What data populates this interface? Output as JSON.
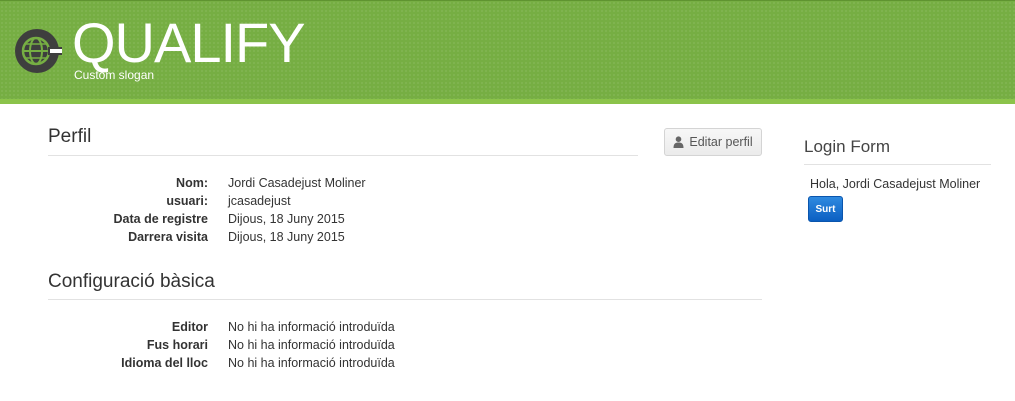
{
  "header": {
    "logo_icon": "globe-logo-icon",
    "site_title": "QUALIFY",
    "slogan": "Custom slogan",
    "colors": {
      "header_bg": "#76ae43",
      "header_stripe": "#8bc34a"
    }
  },
  "profile": {
    "title": "Perfil",
    "edit_button": {
      "label": "Editar perfil",
      "icon": "user-icon"
    },
    "fields": [
      {
        "label": "Nom:",
        "value": "Jordi Casadejust Moliner"
      },
      {
        "label": "usuari:",
        "value": "jcasadejust"
      },
      {
        "label": "Data de registre",
        "value": "Dijous, 18 Juny 2015"
      },
      {
        "label": "Darrera visita",
        "value": "Dijous, 18 Juny 2015"
      }
    ]
  },
  "basic_settings": {
    "title": "Configuració bàsica",
    "fields": [
      {
        "label": "Editor",
        "value": "No hi ha informació introduïda"
      },
      {
        "label": "Fus horari",
        "value": "No hi ha informació introduïda"
      },
      {
        "label": "Idioma del lloc",
        "value": "No hi ha informació introduïda"
      }
    ]
  },
  "sidebar": {
    "title": "Login Form",
    "greeting": "Hola, Jordi Casadejust Moliner",
    "logout_label": "Surt",
    "colors": {
      "logout_bg": "#0b5fc2"
    }
  }
}
